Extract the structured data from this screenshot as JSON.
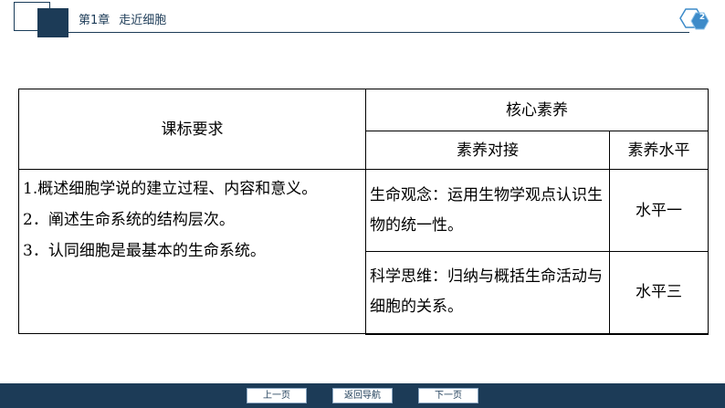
{
  "header": {
    "chapter_label": "第1章",
    "chapter_title": "走近细胞",
    "page_number": "2"
  },
  "table": {
    "col1_header": "课标要求",
    "core_header": "核心素养",
    "sub_header_1": "素养对接",
    "sub_header_2": "素养水平",
    "requirements": [
      "1.概述细胞学说的建立过程、内容和意义。",
      "2．阐述生命系统的结构层次。",
      "3．认同细胞是最基本的生命系统。"
    ],
    "rows": [
      {
        "quality": "生命观念：运用生物学观点认识生物的统一性。",
        "level": "水平一"
      },
      {
        "quality": "科学思维：归纳与概括生命活动与细胞的关系。",
        "level": "水平三"
      }
    ]
  },
  "nav": {
    "prev": "上一页",
    "home": "返回导航",
    "next": "下一页"
  },
  "colors": {
    "brand": "#1c3b57",
    "hex_fill": "#3d8bc9"
  }
}
